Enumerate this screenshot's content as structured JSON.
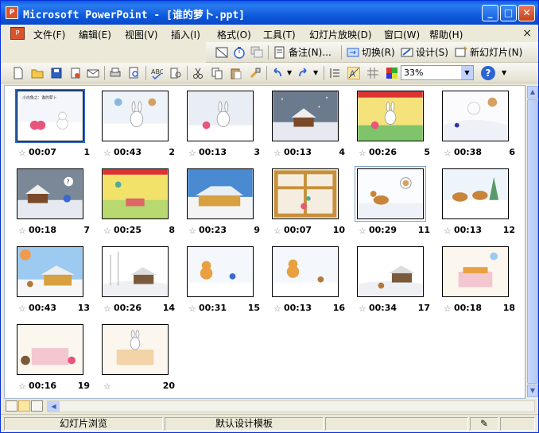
{
  "window": {
    "title": "Microsoft PowerPoint - [谁的萝卜.ppt]",
    "icon": "powerpoint-icon",
    "controls": {
      "minimize": "_",
      "maximize": "□",
      "close": "✕"
    }
  },
  "menu": {
    "items": [
      "文件(F)",
      "编辑(E)",
      "视图(V)",
      "插入(I)",
      "格式(O)",
      "工具(T)",
      "幻灯片放映(D)",
      "窗口(W)",
      "帮助(H)"
    ],
    "close_glyph": "×"
  },
  "slide_sorter_toolbar": {
    "notes": "备注(N)...",
    "transition": "切换(R)",
    "design": "设计(S)",
    "new_slide": "新幻灯片(N)"
  },
  "standard_toolbar": {
    "zoom": "33%",
    "help": "?"
  },
  "slides": [
    {
      "number": "1",
      "timing": "00:07",
      "selected": true
    },
    {
      "number": "2",
      "timing": "00:43"
    },
    {
      "number": "3",
      "timing": "00:13"
    },
    {
      "number": "4",
      "timing": "00:13"
    },
    {
      "number": "5",
      "timing": "00:26"
    },
    {
      "number": "6",
      "timing": "00:38"
    },
    {
      "number": "7",
      "timing": "00:18"
    },
    {
      "number": "8",
      "timing": "00:25"
    },
    {
      "number": "9",
      "timing": "00:23"
    },
    {
      "number": "10",
      "timing": "00:07"
    },
    {
      "number": "11",
      "timing": "00:29",
      "current": true
    },
    {
      "number": "12",
      "timing": "00:13"
    },
    {
      "number": "13",
      "timing": "00:43"
    },
    {
      "number": "14",
      "timing": "00:26"
    },
    {
      "number": "15",
      "timing": "00:31"
    },
    {
      "number": "16",
      "timing": "00:13"
    },
    {
      "number": "17",
      "timing": "00:34"
    },
    {
      "number": "18",
      "timing": "00:18"
    },
    {
      "number": "19",
      "timing": "00:16"
    },
    {
      "number": "20",
      "timing": ""
    }
  ],
  "slide1_caption": "小白兔之：谁的萝卜",
  "status": {
    "view": "幻灯片浏览",
    "template": "默认设计模板"
  },
  "colors": {
    "title_bar": "#0a5fe0",
    "selection": "#316ac5",
    "chrome": "#ece9d8"
  }
}
